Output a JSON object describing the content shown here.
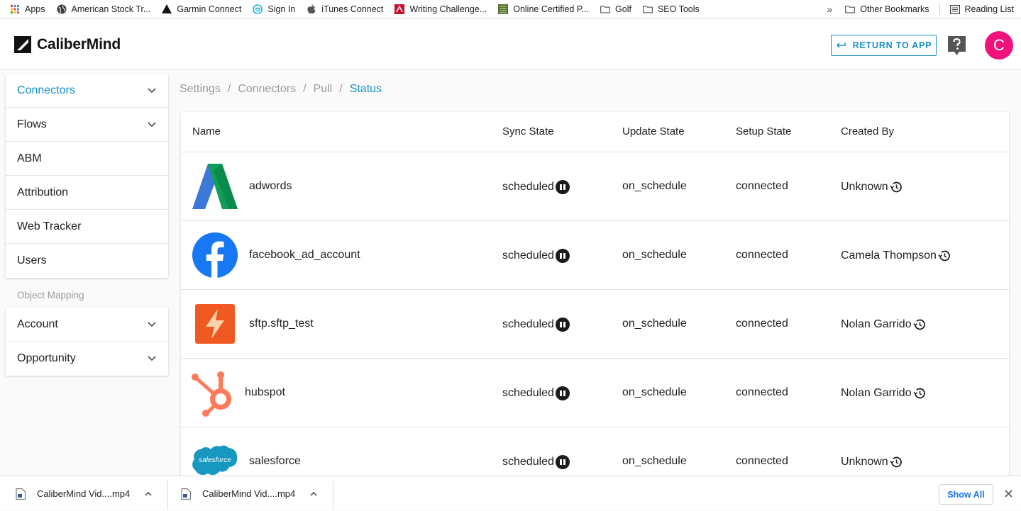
{
  "bookmarks": {
    "items": [
      {
        "label": "Apps",
        "icon": "apps-grid-icon"
      },
      {
        "label": "American Stock Tr...",
        "icon": "globe-icon"
      },
      {
        "label": "Garmin Connect",
        "icon": "garmin-triangle-icon"
      },
      {
        "label": "Sign In",
        "icon": "signin-swirl-icon"
      },
      {
        "label": "iTunes Connect",
        "icon": "apple-icon"
      },
      {
        "label": "Writing Challenge...",
        "icon": "writing-red-icon"
      },
      {
        "label": "Online Certified P...",
        "icon": "certificate-icon"
      },
      {
        "label": "Golf",
        "icon": "folder-icon"
      },
      {
        "label": "SEO Tools",
        "icon": "folder-icon"
      }
    ],
    "overflow": "»",
    "other_bookmarks": "Other Bookmarks",
    "reading_list": "Reading List"
  },
  "header": {
    "brand": "CaliberMind",
    "return_label": "RETURN TO APP",
    "avatar_letter": "C",
    "avatar_color": "#f0127b",
    "accent_color": "#1a8fc7"
  },
  "sidebar": {
    "items": [
      {
        "label": "Connectors",
        "expandable": true,
        "active": true
      },
      {
        "label": "Flows",
        "expandable": true
      },
      {
        "label": "ABM"
      },
      {
        "label": "Attribution"
      },
      {
        "label": "Web Tracker"
      },
      {
        "label": "Users"
      }
    ],
    "section_title": "Object Mapping",
    "mapping_items": [
      {
        "label": "Account",
        "expandable": true
      },
      {
        "label": "Opportunity",
        "expandable": true
      }
    ]
  },
  "breadcrumb": {
    "items": [
      "Settings",
      "Connectors",
      "Pull"
    ],
    "current": "Status",
    "separator": "/"
  },
  "table": {
    "columns": [
      "Name",
      "Sync State",
      "Update State",
      "Setup State",
      "Created By"
    ],
    "rows": [
      {
        "name": "adwords",
        "logo": "adwords-icon",
        "sync": "scheduled",
        "update": "on_schedule",
        "setup": "connected",
        "created_by": "Unknown"
      },
      {
        "name": "facebook_ad_account",
        "logo": "facebook-icon",
        "sync": "scheduled",
        "update": "on_schedule",
        "setup": "connected",
        "created_by": "Camela Thompson"
      },
      {
        "name": "sftp.sftp_test",
        "logo": "sftp-bolt-icon",
        "sync": "scheduled",
        "update": "on_schedule",
        "setup": "connected",
        "created_by": "Nolan Garrido"
      },
      {
        "name": "hubspot",
        "logo": "hubspot-icon",
        "sync": "scheduled",
        "update": "on_schedule",
        "setup": "connected",
        "created_by": "Nolan Garrido"
      },
      {
        "name": "salesforce",
        "logo": "salesforce-icon",
        "logo_text": "salesforce",
        "sync": "scheduled",
        "update": "on_schedule",
        "setup": "connected",
        "created_by": "Unknown"
      }
    ]
  },
  "downloads": {
    "items": [
      {
        "label": "CaliberMind Vid....mp4"
      },
      {
        "label": "CaliberMind Vid....mp4"
      }
    ],
    "show_all": "Show All"
  }
}
